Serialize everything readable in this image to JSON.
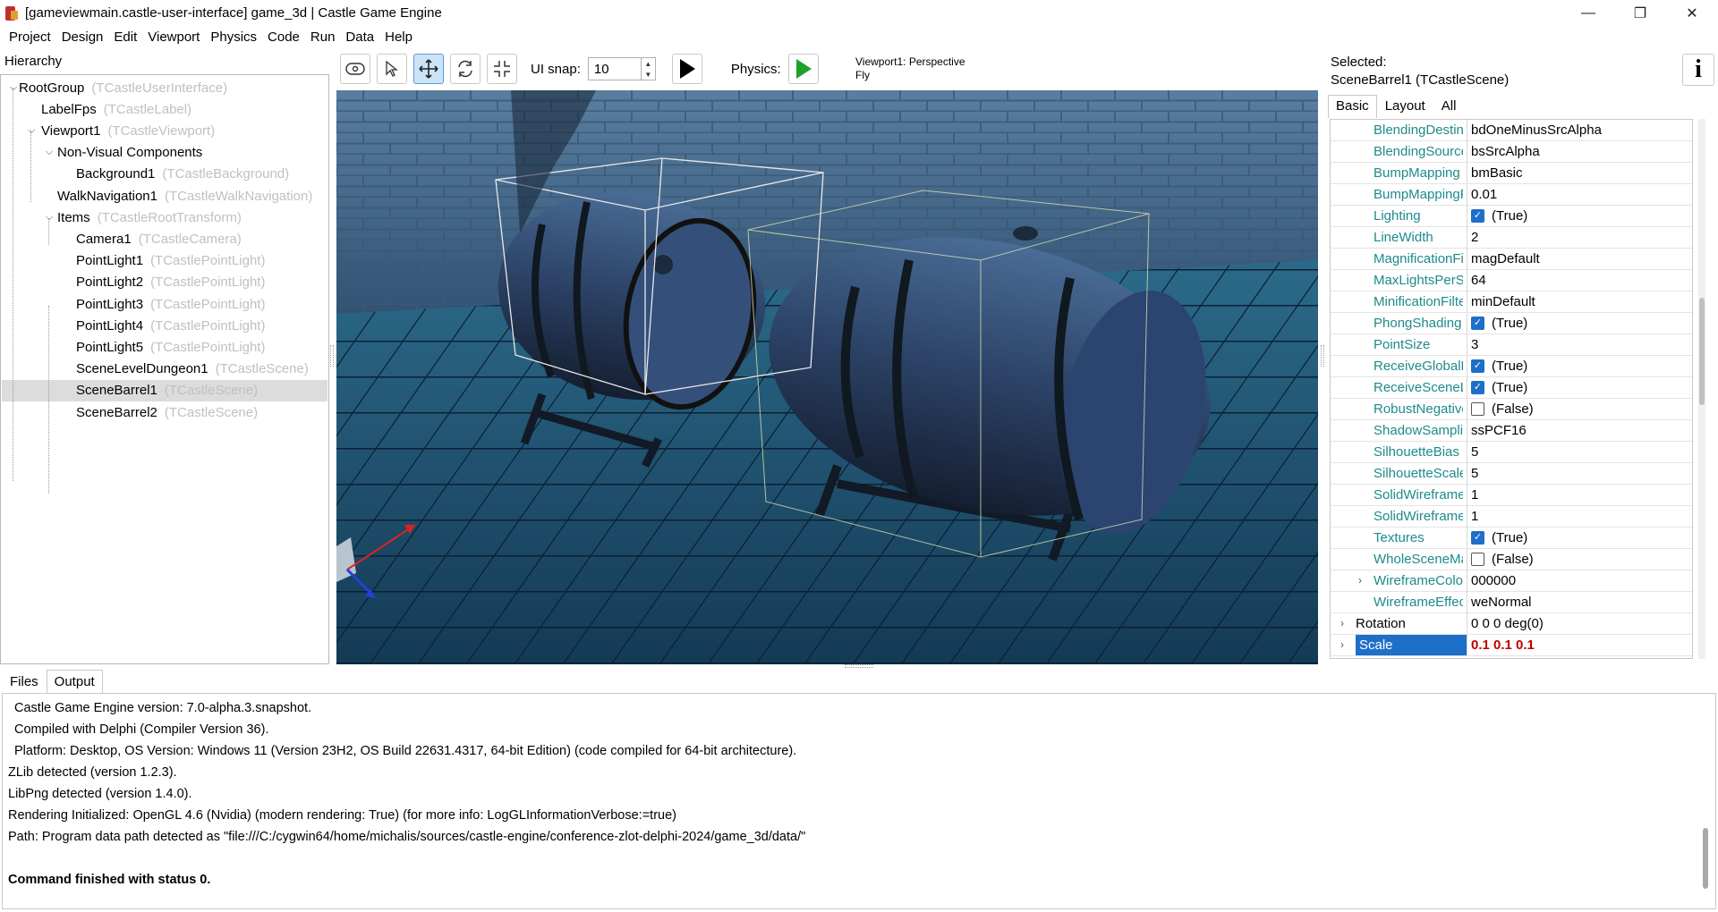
{
  "window": {
    "title": "[gameviewmain.castle-user-interface] game_3d | Castle Game Engine",
    "controls": {
      "minimize": "—",
      "maximize": "❐",
      "close": "✕"
    }
  },
  "menu": [
    "Project",
    "Design",
    "Edit",
    "Viewport",
    "Physics",
    "Code",
    "Run",
    "Data",
    "Help"
  ],
  "hierarchy": {
    "label": "Hierarchy",
    "items": [
      {
        "name": "RootGroup",
        "cls": "(TCastleUserInterface)"
      },
      {
        "name": "LabelFps",
        "cls": "(TCastleLabel)"
      },
      {
        "name": "Viewport1",
        "cls": "(TCastleViewport)"
      },
      {
        "name": "Non-Visual Components",
        "cls": ""
      },
      {
        "name": "Background1",
        "cls": "(TCastleBackground)"
      },
      {
        "name": "WalkNavigation1",
        "cls": "(TCastleWalkNavigation)"
      },
      {
        "name": "Items",
        "cls": "(TCastleRootTransform)"
      },
      {
        "name": "Camera1",
        "cls": "(TCastleCamera)"
      },
      {
        "name": "PointLight1",
        "cls": "(TCastlePointLight)"
      },
      {
        "name": "PointLight2",
        "cls": "(TCastlePointLight)"
      },
      {
        "name": "PointLight3",
        "cls": "(TCastlePointLight)"
      },
      {
        "name": "PointLight4",
        "cls": "(TCastlePointLight)"
      },
      {
        "name": "PointLight5",
        "cls": "(TCastlePointLight)"
      },
      {
        "name": "SceneLevelDungeon1",
        "cls": "(TCastleScene)"
      },
      {
        "name": "SceneBarrel1",
        "cls": "(TCastleScene)"
      },
      {
        "name": "SceneBarrel2",
        "cls": "(TCastleScene)"
      }
    ]
  },
  "toolbar": {
    "ui_snap_label": "UI snap:",
    "ui_snap_value": "10",
    "physics_label": "Physics:"
  },
  "viewport_info": {
    "line1": "Viewport1: Perspective",
    "line2": "Fly"
  },
  "inspector": {
    "selected_label": "Selected:",
    "selected_name": "SceneBarrel1 (TCastleScene)",
    "info_glyph": "i",
    "tabs": [
      "Basic",
      "Layout",
      "All"
    ],
    "properties": [
      {
        "name": "BlendingDestination",
        "value": "bdOneMinusSrcAlpha"
      },
      {
        "name": "BlendingSource",
        "value": "bsSrcAlpha"
      },
      {
        "name": "BumpMapping",
        "value": "bmBasic"
      },
      {
        "name": "BumpMappingParallaxHeight",
        "value": "0.01"
      },
      {
        "name": "Lighting",
        "value": "(True)",
        "check": true
      },
      {
        "name": "LineWidth",
        "value": "2"
      },
      {
        "name": "MagnificationFilter",
        "value": "magDefault"
      },
      {
        "name": "MaxLightsPerShape",
        "value": "64"
      },
      {
        "name": "MinificationFilter",
        "value": "minDefault"
      },
      {
        "name": "PhongShading",
        "value": "(True)",
        "check": true
      },
      {
        "name": "PointSize",
        "value": "3"
      },
      {
        "name": "ReceiveGlobalLights",
        "value": "(True)",
        "check": true
      },
      {
        "name": "ReceiveSceneLights",
        "value": "(True)",
        "check": true
      },
      {
        "name": "RobustNegativeScale",
        "value": "(False)",
        "check": false
      },
      {
        "name": "ShadowSampling",
        "value": "ssPCF16"
      },
      {
        "name": "SilhouetteBias",
        "value": "5"
      },
      {
        "name": "SilhouetteScale",
        "value": "5"
      },
      {
        "name": "SolidWireframeBias",
        "value": "1"
      },
      {
        "name": "SolidWireframeScale",
        "value": "1"
      },
      {
        "name": "Textures",
        "value": "(True)",
        "check": true
      },
      {
        "name": "WholeSceneManifold",
        "value": "(False)",
        "check": false
      },
      {
        "name": "WireframeColor",
        "value": "000000",
        "expand": true
      },
      {
        "name": "WireframeEffect",
        "value": "weNormal"
      },
      {
        "name": "Rotation",
        "value": "0 0 0 deg(0)",
        "expand": true,
        "top": true
      },
      {
        "name": "Scale",
        "value": "0.1 0.1 0.1",
        "expand": true,
        "top": true,
        "selected": true
      }
    ]
  },
  "bottom": {
    "tabs": [
      "Files",
      "Output"
    ],
    "lines": [
      {
        "text": "Castle Game Engine version: 7.0-alpha.3.snapshot.",
        "indent": true
      },
      {
        "text": "Compiled with Delphi (Compiler Version 36).",
        "indent": true
      },
      {
        "text": "Platform: Desktop, OS Version: Windows 11 (Version 23H2, OS Build 22631.4317, 64-bit Edition) (code compiled for 64-bit architecture).",
        "indent": true
      },
      {
        "text": "ZLib detected (version 1.2.3)."
      },
      {
        "text": "LibPng detected (version 1.4.0)."
      },
      {
        "text": "Rendering Initialized: OpenGL 4.6 (Nvidia) (modern rendering: True) (for more info: LogGLInformationVerbose:=true)"
      },
      {
        "text": "Path: Program data path detected as \"file:///C:/cygwin64/home/michalis/sources/castle-engine/conference-zlot-delphi-2024/game_3d/data/\""
      },
      {
        "text": ""
      },
      {
        "text": "Command finished with status 0.",
        "bold": true
      }
    ]
  },
  "colors": {
    "accent": "#1e6fc8",
    "property_name": "#1e8a8a",
    "play_green": "#1fa02a"
  }
}
